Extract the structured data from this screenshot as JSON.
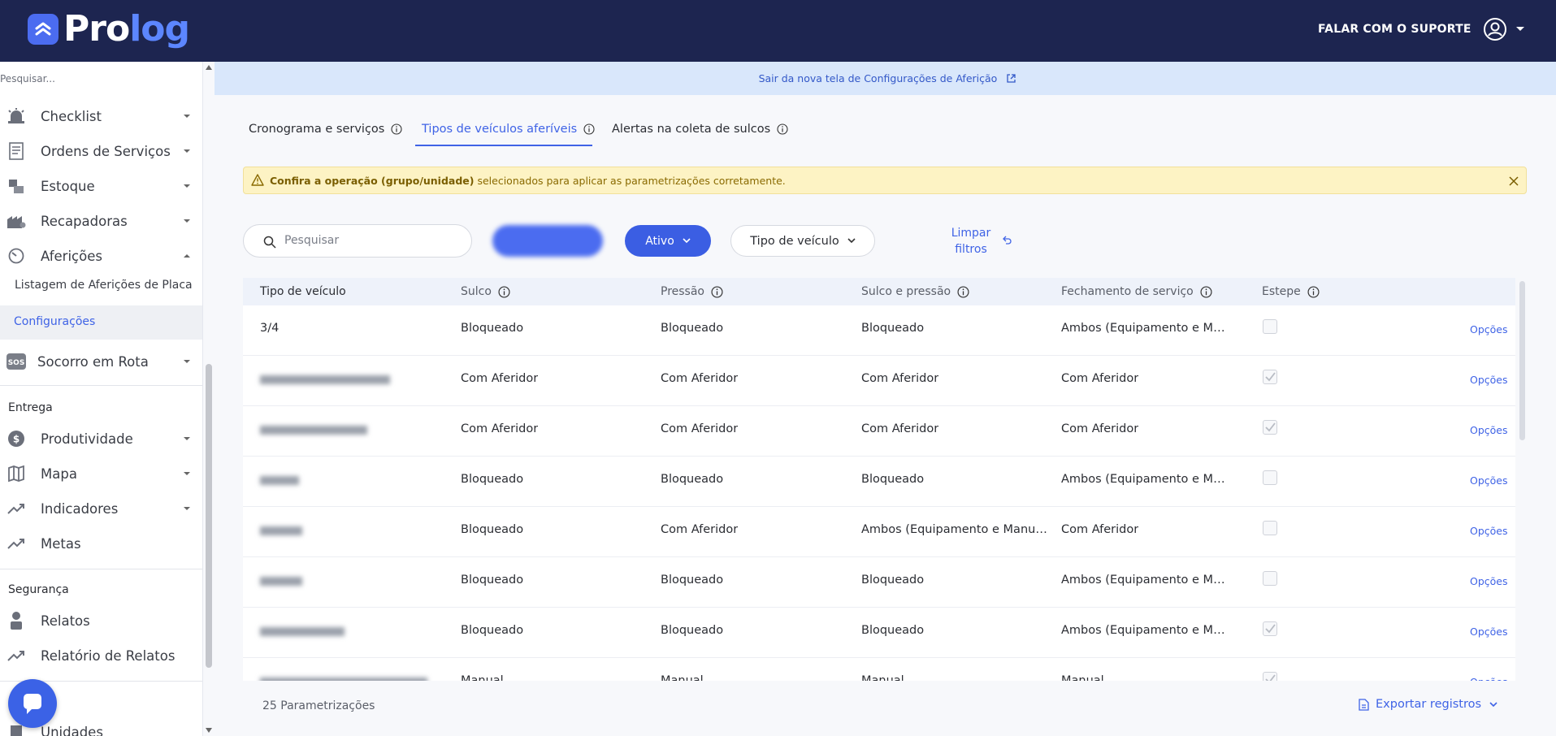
{
  "header": {
    "logo_part1": "Pro",
    "logo_part2": "log",
    "support_label": "FALAR COM O SUPORTE"
  },
  "sidebar": {
    "search_placeholder": "Pesquisar...",
    "items": [
      {
        "label": "Checklist",
        "icon": "alarm-icon"
      },
      {
        "label": "Ordens de Serviços",
        "icon": "document-icon"
      },
      {
        "label": "Estoque",
        "icon": "boxes-icon"
      },
      {
        "label": "Recapadoras",
        "icon": "factory-icon"
      },
      {
        "label": "Aferições",
        "icon": "gauge-icon"
      }
    ],
    "sub_items": [
      "Listagem de Aferições de Placa",
      "Configurações"
    ],
    "socorro": "Socorro em Rota",
    "socorro_icon_text": "SOS",
    "section_entrega": "Entrega",
    "entrega_items": [
      "Produtividade",
      "Mapa",
      "Indicadores",
      "Metas"
    ],
    "section_seguranca": "Segurança",
    "seguranca_items": [
      "Relatos",
      "Relatório de Relatos"
    ],
    "bottom_item": "Unidades"
  },
  "banner": {
    "text": "Sair da nova tela de Configurações de Aferição"
  },
  "tabs": [
    {
      "label": "Cronograma e serviços",
      "active": false
    },
    {
      "label": "Tipos de veículos aferíveis",
      "active": true
    },
    {
      "label": "Alertas na coleta de sulcos",
      "active": false
    }
  ],
  "alert": {
    "bold": "Confira a operação (grupo/unidade)",
    "rest": " selecionados para aplicar as parametrizações corretamente."
  },
  "filters": {
    "search_placeholder": "Pesquisar",
    "status": "Ativo",
    "vehicle_type": "Tipo de veículo",
    "clear_line1": "Limpar",
    "clear_line2": "filtros"
  },
  "table": {
    "headers": [
      "Tipo de veículo",
      "Sulco",
      "Pressão",
      "Sulco e pressão",
      "Fechamento de serviço",
      "Estepe"
    ],
    "options_label": "Opções",
    "rows": [
      {
        "tipo": "3/4",
        "sulco": "Bloqueado",
        "pressao": "Bloqueado",
        "sulco_pressao": "Bloqueado",
        "fechamento": "Ambos (Equipamento e Manual)",
        "estepe": false
      },
      {
        "tipo": "",
        "sulco": "Com Aferidor",
        "pressao": "Com Aferidor",
        "sulco_pressao": "Com Aferidor",
        "fechamento": "Com Aferidor",
        "estepe": true
      },
      {
        "tipo": "",
        "sulco": "Com Aferidor",
        "pressao": "Com Aferidor",
        "sulco_pressao": "Com Aferidor",
        "fechamento": "Com Aferidor",
        "estepe": true
      },
      {
        "tipo": "",
        "sulco": "Bloqueado",
        "pressao": "Bloqueado",
        "sulco_pressao": "Bloqueado",
        "fechamento": "Ambos (Equipamento e Manual)",
        "estepe": false
      },
      {
        "tipo": "",
        "sulco": "Bloqueado",
        "pressao": "Com Aferidor",
        "sulco_pressao": "Ambos (Equipamento e Manual)",
        "fechamento": "Com Aferidor",
        "estepe": false
      },
      {
        "tipo": "",
        "sulco": "Bloqueado",
        "pressao": "Bloqueado",
        "sulco_pressao": "Bloqueado",
        "fechamento": "Ambos (Equipamento e Manual)",
        "estepe": false
      },
      {
        "tipo": "",
        "sulco": "Bloqueado",
        "pressao": "Bloqueado",
        "sulco_pressao": "Bloqueado",
        "fechamento": "Ambos (Equipamento e Manual)",
        "estepe": true
      },
      {
        "tipo": "",
        "sulco": "Manual",
        "pressao": "Manual",
        "sulco_pressao": "Manual",
        "fechamento": "Manual",
        "estepe": true
      }
    ]
  },
  "footer": {
    "count": "25 Parametrizações",
    "export_label": "Exportar registros"
  }
}
